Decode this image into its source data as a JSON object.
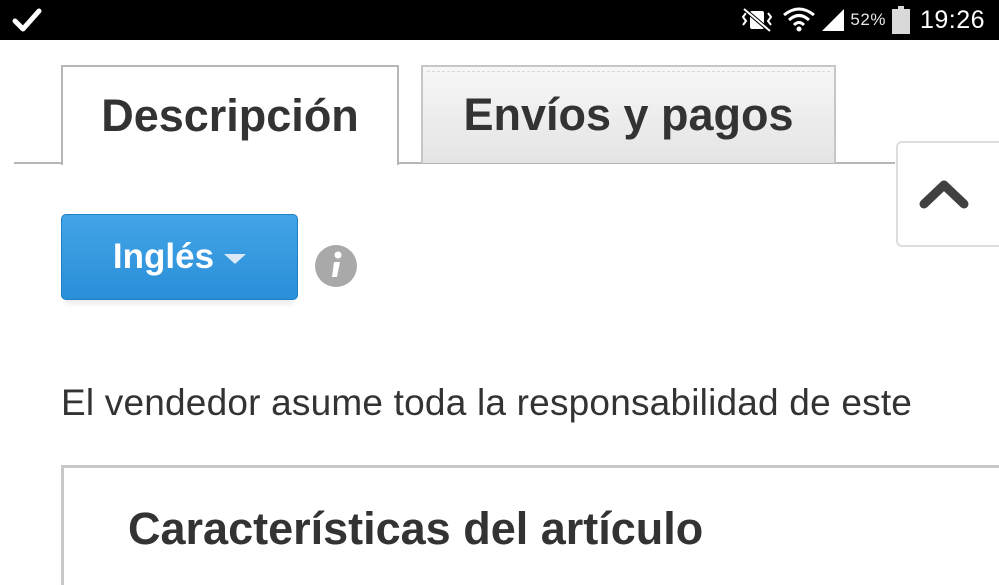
{
  "status_bar": {
    "notification_icon": "checkmark-icon",
    "icons": [
      "vibrate-mute-icon",
      "wifi-icon",
      "signal-icon",
      "battery-icon"
    ],
    "battery_percent": "52%",
    "time": "19:26"
  },
  "tabs": [
    {
      "label": "Descripción",
      "active": true
    },
    {
      "label": "Envíos y pagos",
      "active": false
    }
  ],
  "language_selector": {
    "label": "Inglés",
    "icon": "caret-down-icon",
    "color": "#2f96dd"
  },
  "info_icon": "info-icon",
  "back_to_top_icon": "chevron-up-icon",
  "seller_notice": "El vendedor asume toda la responsabilidad de este",
  "section": {
    "title": "Características del artículo"
  }
}
